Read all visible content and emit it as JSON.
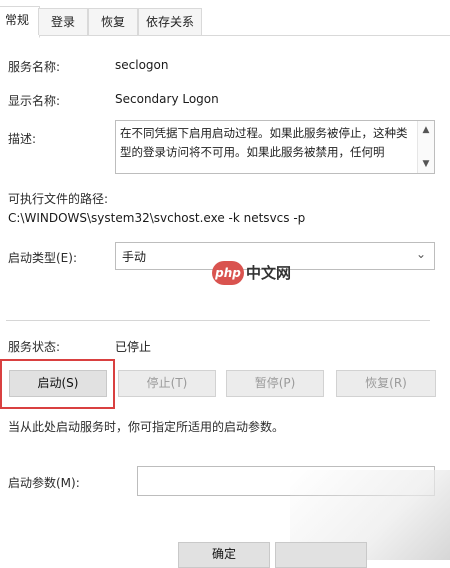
{
  "tabs": [
    {
      "label": "常规",
      "active": true
    },
    {
      "label": "登录",
      "active": false
    },
    {
      "label": "恢复",
      "active": false
    },
    {
      "label": "依存关系",
      "active": false
    }
  ],
  "service_name": {
    "label": "服务名称:",
    "value": "seclogon"
  },
  "display_name": {
    "label": "显示名称:",
    "value": "Secondary Logon"
  },
  "description": {
    "label": "描述:",
    "text": "在不同凭据下启用启动过程。如果此服务被停止，这种类型的登录访问将不可用。如果此服务被禁用，任何明"
  },
  "executable": {
    "label": "可执行文件的路径:",
    "path": "C:\\WINDOWS\\system32\\svchost.exe -k netsvcs -p"
  },
  "startup_type": {
    "label": "启动类型(E):",
    "value": "手动"
  },
  "service_status": {
    "label": "服务状态:",
    "value": "已停止"
  },
  "buttons": {
    "start": "启动(S)",
    "stop": "停止(T)",
    "pause": "暂停(P)",
    "resume": "恢复(R)"
  },
  "hint": "当从此处启动服务时，你可指定所适用的启动参数。",
  "start_params": {
    "label": "启动参数(M):",
    "value": ""
  },
  "dialog_buttons": {
    "ok": "确定",
    "cancel": ""
  },
  "watermark": {
    "logo": "php",
    "text": "中文网"
  },
  "colors": {
    "highlight": "#d94040",
    "watermark": "#d9534f"
  }
}
